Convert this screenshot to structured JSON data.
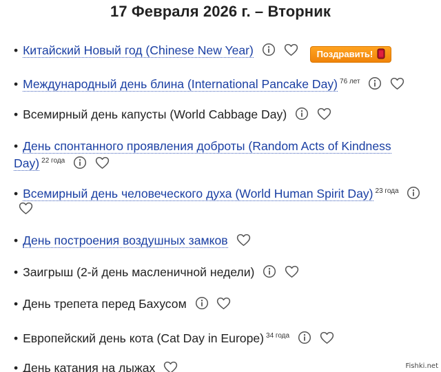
{
  "header": {
    "title": "17 Февраля 2026 г. – Вторник"
  },
  "bullet": "•",
  "holidays": [
    {
      "name": "Китайский Новый год (Chinese New Year)",
      "linked": true,
      "age": "",
      "info": true,
      "like": true,
      "congrats": "Поздравить!"
    },
    {
      "name": "Международный день блина (International Pancake Day)",
      "linked": true,
      "age": "76 лет",
      "info": true,
      "like": true
    },
    {
      "name": "Всемирный день капусты (World Cabbage Day)",
      "linked": false,
      "age": "",
      "info": true,
      "like": true
    },
    {
      "name": "День спонтанного проявления доброты (Random Acts of Kindness Day)",
      "linked": true,
      "age": "22 года",
      "info": true,
      "like": true
    },
    {
      "name": "Всемирный день человеческого духа (World Human Spirit Day)",
      "linked": true,
      "age": "23 года",
      "info": true,
      "like": true
    },
    {
      "name": "День построения воздушных замков",
      "linked": true,
      "age": "",
      "info": false,
      "like": true
    },
    {
      "name": "Заигрыш (2-й день масленичной недели)",
      "linked": false,
      "age": "",
      "info": true,
      "like": true
    },
    {
      "name": "День трепета перед Бахусом",
      "linked": false,
      "age": "",
      "info": true,
      "like": true
    },
    {
      "name": "Европейский день кота (Cat Day in Europe)",
      "linked": false,
      "age": "34 года",
      "info": true,
      "like": true
    },
    {
      "name": "День катания на лыжах",
      "linked": false,
      "age": "",
      "info": false,
      "like": true
    }
  ],
  "icons": {
    "info": "info-circle-icon",
    "like": "heart-outline-icon",
    "gift": "gift-card-icon"
  },
  "colors": {
    "link": "#1a3fa3",
    "button": "#f28a0c",
    "icon": "#555555"
  },
  "watermark": "Fishki.net"
}
